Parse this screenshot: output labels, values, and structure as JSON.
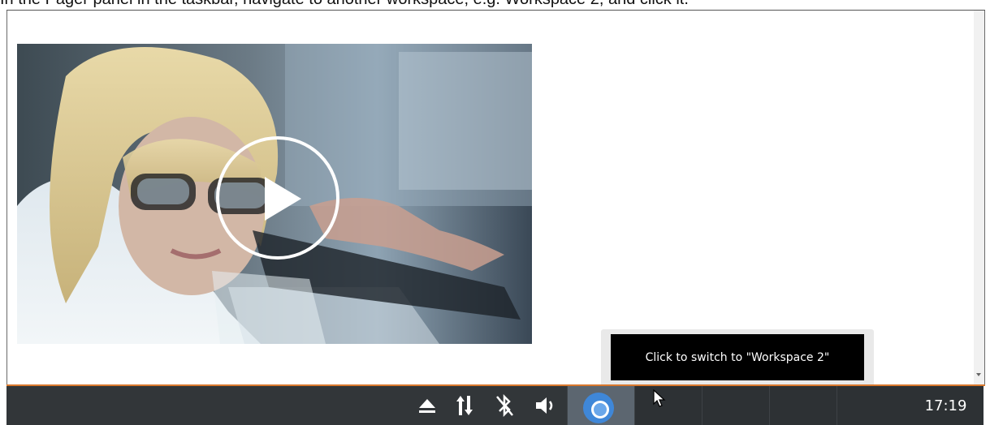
{
  "instruction": {
    "text": "In the Pager panel in the taskbar, navigate to another workspace, e.g. Workspace 2, and click it."
  },
  "video": {
    "play_icon": "play-icon"
  },
  "tooltip": {
    "text": "Click to switch to \"Workspace 2\""
  },
  "taskbar": {
    "tray_icons": [
      "eject-icon",
      "network-transfer-icon",
      "bluetooth-disabled-icon",
      "volume-icon"
    ],
    "app_icon": "chromium-icon",
    "clock": "17:19",
    "colors": {
      "taskbar_bg": "#323639",
      "accent_line": "#d9782d",
      "active_workspace": "#5c6670"
    }
  }
}
